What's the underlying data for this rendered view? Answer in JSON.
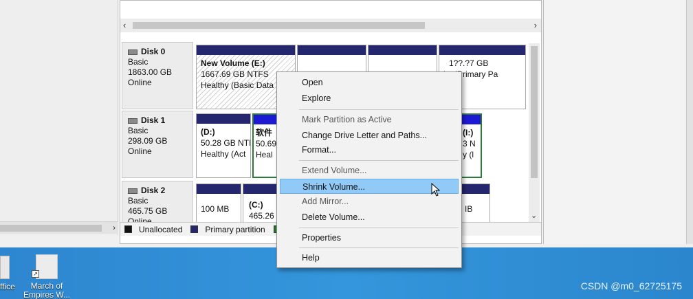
{
  "disks": [
    {
      "name": "Disk 0",
      "type": "Basic",
      "size": "1863.00 GB",
      "status": "Online",
      "partitions": [
        {
          "name": "New Volume  (E:)",
          "size": "1667.69 GB NTFS",
          "status": "Healthy (Basic Data P"
        },
        {
          "name": "",
          "size": "",
          "status": ""
        },
        {
          "name": "",
          "size": "",
          "status": ""
        },
        {
          "name": "",
          "size": "1??.?7 GB",
          "status": "hy (Primary Pa"
        }
      ]
    },
    {
      "name": "Disk 1",
      "type": "Basic",
      "size": "298.09 GB",
      "status": "Online",
      "partitions": [
        {
          "name": "(D:)",
          "size": "50.28 GB NTI",
          "status": "Healthy (Act"
        },
        {
          "name": "软件",
          "size": "50.69",
          "status": "Heal"
        },
        {
          "name": "(I:)",
          "size": "3 N",
          "status": "y (l"
        }
      ]
    },
    {
      "name": "Disk 2",
      "type": "Basic",
      "size": "465.75 GB",
      "status": "Online",
      "partitions": [
        {
          "name": "",
          "size": "100 MB",
          "status": ""
        },
        {
          "name": "(C:)",
          "size": "465.26 G",
          "status": ""
        },
        {
          "name": "",
          "size": "IB",
          "status": ""
        }
      ]
    }
  ],
  "legend": {
    "unallocated": "Unallocated",
    "primary": "Primary partition",
    "extended": "E"
  },
  "context_menu": {
    "items": [
      {
        "label": "Open",
        "disabled": false
      },
      {
        "label": "Explore",
        "disabled": false
      },
      {
        "label": "Mark Partition as Active",
        "disabled": true
      },
      {
        "label": "Change Drive Letter and Paths...",
        "disabled": false
      },
      {
        "label": "Format...",
        "disabled": false
      },
      {
        "label": "Extend Volume...",
        "disabled": true
      },
      {
        "label": "Shrink Volume...",
        "disabled": false,
        "highlighted": true
      },
      {
        "label": "Add Mirror...",
        "disabled": true
      },
      {
        "label": "Delete Volume...",
        "disabled": false
      },
      {
        "label": "Properties",
        "disabled": false
      },
      {
        "label": "Help",
        "disabled": false
      }
    ]
  },
  "desktop": {
    "left_label": "ffice",
    "icon_label": "March of Empires W..."
  },
  "watermark": "CSDN @m0_62725175",
  "colors": {
    "primary_partition": "#25276e",
    "logical_partition": "#1d1ad4",
    "extended_partition": "#1f5f1f",
    "menu_highlight": "#91c9f7",
    "desktop": "#2f8fd6"
  }
}
